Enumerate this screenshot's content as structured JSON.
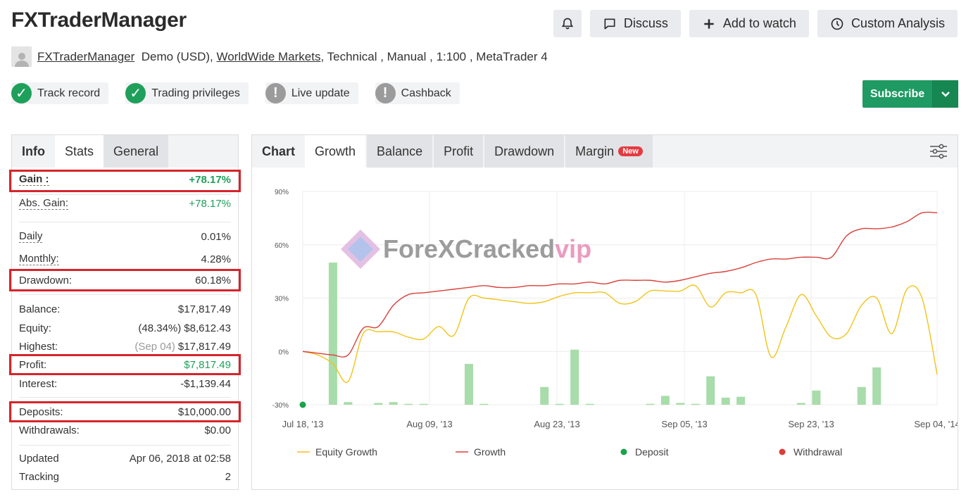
{
  "title": "FXTraderManager",
  "actions": {
    "bell_icon": "bell-icon",
    "discuss": "Discuss",
    "add_to_watch": "Add to watch",
    "custom_analysis": "Custom Analysis"
  },
  "meta": {
    "owner": "FXTraderManager",
    "account_type": "Demo (USD),",
    "broker": "WorldWide Markets",
    "details": ", Technical , Manual , 1:100 , MetaTrader 4"
  },
  "badges": [
    {
      "label": "Track record",
      "status": "ok"
    },
    {
      "label": "Trading privileges",
      "status": "ok"
    },
    {
      "label": "Live update",
      "status": "warn"
    },
    {
      "label": "Cashback",
      "status": "warn"
    }
  ],
  "subscribe": "Subscribe",
  "left_tabs": [
    "Info",
    "Stats",
    "General"
  ],
  "stats": {
    "gain": {
      "label": "Gain :",
      "value": "+78.17%"
    },
    "abs_gain": {
      "label": "Abs. Gain:",
      "value": "+78.17%"
    },
    "daily": {
      "label": "Daily",
      "value": "0.01%"
    },
    "monthly": {
      "label": "Monthly:",
      "value": "4.28%"
    },
    "drawdown": {
      "label": "Drawdown:",
      "value": "60.18%"
    },
    "balance": {
      "label": "Balance:",
      "value": "$17,817.49"
    },
    "equity": {
      "label": "Equity:",
      "note": "(48.34%)",
      "value": "$8,612.43"
    },
    "highest": {
      "label": "Highest:",
      "note": "(Sep 04)",
      "value": "$17,817.49"
    },
    "profit": {
      "label": "Profit:",
      "value": "$7,817.49"
    },
    "interest": {
      "label": "Interest:",
      "value": "-$1,139.44"
    },
    "deposits": {
      "label": "Deposits:",
      "value": "$10,000.00"
    },
    "withdrawals": {
      "label": "Withdrawals:",
      "value": "$0.00"
    },
    "updated": {
      "label": "Updated",
      "value": "Apr 06, 2018 at 02:58"
    },
    "tracking": {
      "label": "Tracking",
      "value": "2"
    }
  },
  "chart_tabs": {
    "chart": "Chart",
    "growth": "Growth",
    "balance": "Balance",
    "profit": "Profit",
    "drawdown": "Drawdown",
    "margin": "Margin",
    "new_badge": "New"
  },
  "watermark": {
    "text": "ForeXCracked",
    "vip": "vip"
  },
  "colors": {
    "green": "#1ea05a",
    "equity": "#f0c419",
    "growth": "#d9403a",
    "bars": "#a8dcaa",
    "deposit": "#19a34a",
    "withdrawal": "#d9403a"
  },
  "chart_data": {
    "type": "line",
    "y_ticks": [
      "90%",
      "60%",
      "30%",
      "0%",
      "-30%"
    ],
    "ylim": [
      -30,
      90
    ],
    "x_ticks": [
      "Jul 18, '13",
      "Aug 09, '13",
      "Aug 23, '13",
      "Sep 05, '13",
      "Sep 23, '13",
      "Sep 04, '14"
    ],
    "series": [
      {
        "name": "Equity Growth",
        "kind": "line",
        "values": [
          0,
          -2,
          -7,
          -17,
          10,
          11,
          11,
          8,
          7,
          14,
          9,
          30,
          30,
          29,
          28,
          27,
          28,
          31,
          33,
          33,
          33,
          27,
          28,
          34,
          34,
          34,
          37,
          25,
          33,
          33,
          32,
          -3,
          14,
          32,
          20,
          8,
          10,
          26,
          30,
          10,
          35,
          30,
          -13
        ]
      },
      {
        "name": "Growth",
        "kind": "line",
        "values": [
          0,
          -1,
          -2,
          -2,
          13,
          14,
          26,
          32,
          33,
          34,
          35,
          36,
          37,
          36,
          36,
          37,
          37,
          38,
          38,
          39,
          38,
          40,
          40,
          40,
          39,
          40,
          42,
          44,
          45,
          47,
          50,
          52,
          52,
          53,
          53,
          53,
          65,
          69,
          69,
          70,
          73,
          78,
          78
        ]
      },
      {
        "name": "bars",
        "kind": "bar",
        "values": [
          0,
          0,
          80,
          1,
          0,
          0,
          1,
          1,
          0,
          0,
          0,
          0,
          0,
          0,
          0,
          0,
          0,
          0,
          0,
          0,
          0,
          0,
          0,
          0,
          0,
          0,
          0,
          0,
          0,
          0,
          0,
          0,
          0,
          0,
          0,
          0,
          0,
          0,
          0,
          0,
          0,
          0,
          0
        ]
      }
    ],
    "bars": [
      {
        "x": 2,
        "v": 80
      },
      {
        "x": 3,
        "v": 1.5
      },
      {
        "x": 5,
        "v": 1
      },
      {
        "x": 6,
        "v": 1.5
      },
      {
        "x": 7,
        "v": 0.5
      },
      {
        "x": 8,
        "v": 0.5
      },
      {
        "x": 11,
        "v": 23
      },
      {
        "x": 12,
        "v": 0.5
      },
      {
        "x": 16,
        "v": 10
      },
      {
        "x": 17,
        "v": 0.5
      },
      {
        "x": 18,
        "v": 31
      },
      {
        "x": 19,
        "v": 0.5
      },
      {
        "x": 23,
        "v": 0.5
      },
      {
        "x": 24,
        "v": 5
      },
      {
        "x": 25,
        "v": 1
      },
      {
        "x": 26,
        "v": 0.5
      },
      {
        "x": 27,
        "v": 16
      },
      {
        "x": 28,
        "v": 4
      },
      {
        "x": 29,
        "v": 4.5
      },
      {
        "x": 33,
        "v": 1
      },
      {
        "x": 34,
        "v": 8
      },
      {
        "x": 37,
        "v": 10
      },
      {
        "x": 38,
        "v": 21
      }
    ],
    "deposit_point": {
      "x": 0,
      "v": -30
    },
    "legend": [
      "Equity Growth",
      "Growth",
      "Deposit",
      "Withdrawal"
    ]
  }
}
